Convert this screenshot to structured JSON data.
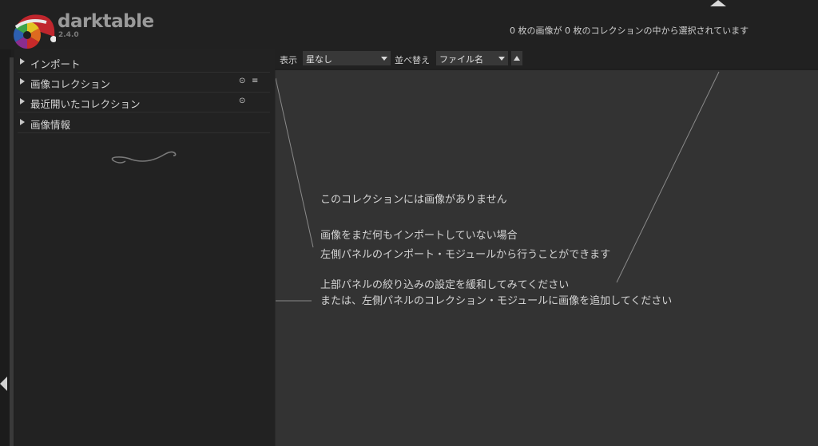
{
  "app": {
    "name": "darktable",
    "version": "2.4.0"
  },
  "header": {
    "status": "0 枚の画像が 0 枚のコレクションの中から選択されています"
  },
  "left_panel": {
    "modules": [
      {
        "label": "インポート",
        "icons": []
      },
      {
        "label": "画像コレクション",
        "icons": [
          "reset-icon",
          "presets-icon"
        ]
      },
      {
        "label": "最近開いたコレクション",
        "icons": [
          "reset-icon"
        ]
      },
      {
        "label": "画像情報",
        "icons": []
      }
    ]
  },
  "toolbar": {
    "filter_label": "表示",
    "filter_value": "星なし",
    "sort_label": "並べ替え",
    "sort_value": "ファイル名",
    "sort_direction": "ascending"
  },
  "empty_view": {
    "title": "このコレクションには画像がありません",
    "hint1_line1": "画像をまだ何もインポートしていない場合",
    "hint1_line2": "左側パネルのインポート・モジュールから行うことができます",
    "hint2_line1": "上部パネルの絞り込みの設定を緩和してみてください",
    "hint2_line2": "または、左側パネルのコレクション・モジュールに画像を追加してください"
  },
  "colors": {
    "background": "#1f1f1f",
    "center": "#333333",
    "text": "#d4d4d4",
    "logo_hat": "#c0262d"
  }
}
